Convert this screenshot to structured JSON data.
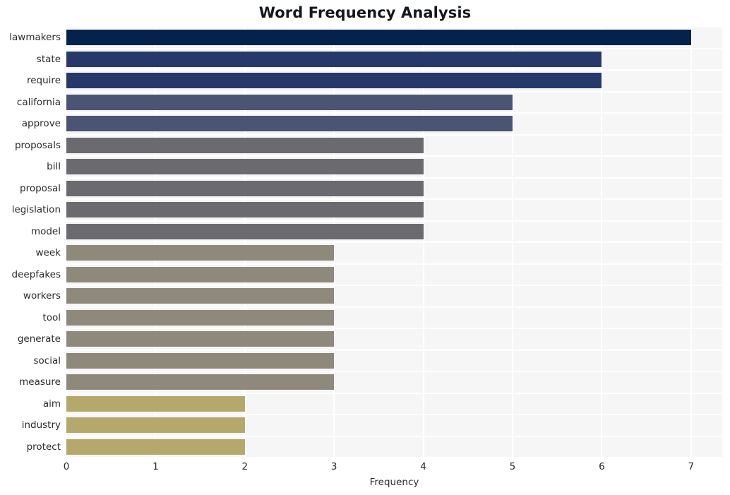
{
  "chart_data": {
    "type": "bar",
    "orientation": "horizontal",
    "title": "Word Frequency Analysis",
    "xlabel": "Frequency",
    "ylabel": "",
    "xlim": [
      0,
      7.35
    ],
    "xticks": [
      0,
      1,
      2,
      3,
      4,
      5,
      6,
      7
    ],
    "xtick_labels": [
      "0",
      "1",
      "2",
      "3",
      "4",
      "5",
      "6",
      "7"
    ],
    "grid": true,
    "legend": null,
    "categories": [
      "lawmakers",
      "state",
      "require",
      "california",
      "approve",
      "proposals",
      "bill",
      "proposal",
      "legislation",
      "model",
      "week",
      "deepfakes",
      "workers",
      "tool",
      "generate",
      "social",
      "measure",
      "aim",
      "industry",
      "protect"
    ],
    "values": [
      7,
      6,
      6,
      5,
      5,
      4,
      4,
      4,
      4,
      4,
      3,
      3,
      3,
      3,
      3,
      3,
      3,
      2,
      2,
      2
    ],
    "bar_colors": [
      "#04224c",
      "#27386b",
      "#27386b",
      "#4b5573",
      "#4b5573",
      "#6b6b6f",
      "#6b6b6f",
      "#6b6b6f",
      "#6b6b6f",
      "#6b6b6f",
      "#8e897a",
      "#8e897a",
      "#8e897a",
      "#8e897a",
      "#8e897a",
      "#8e897a",
      "#8e897a",
      "#b4a86c",
      "#b4a86c",
      "#b4a86c"
    ],
    "plot_background": "#f6f6f7",
    "gridline_color": "#ffffff",
    "figure_background": "#ffffff"
  }
}
